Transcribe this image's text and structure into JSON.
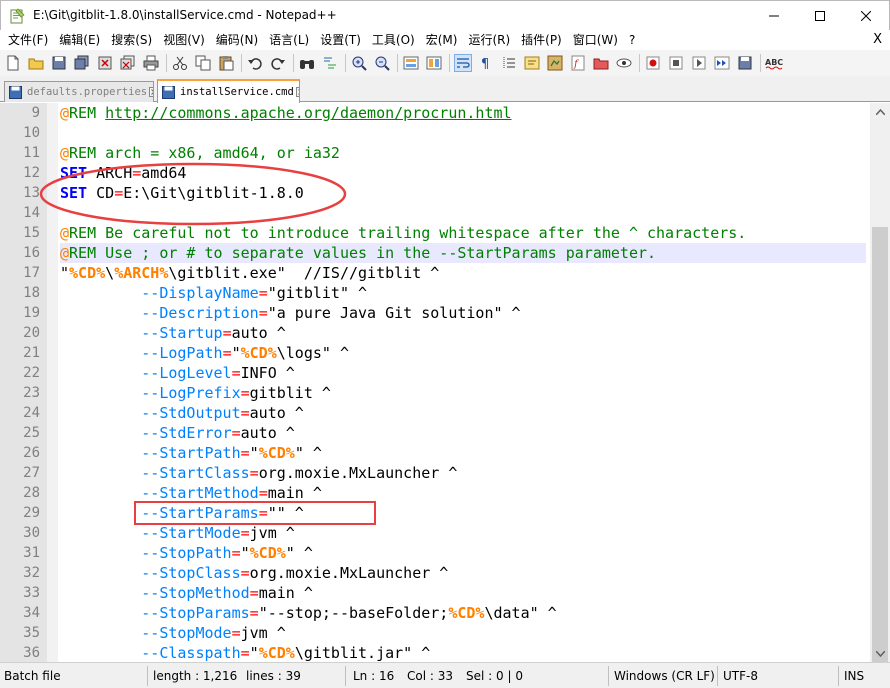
{
  "window": {
    "title": "E:\\Git\\gitblit-1.8.0\\installService.cmd - Notepad++"
  },
  "menu": {
    "items": [
      "文件(F)",
      "编辑(E)",
      "搜索(S)",
      "视图(V)",
      "编码(N)",
      "语言(L)",
      "设置(T)",
      "工具(O)",
      "宏(M)",
      "运行(R)",
      "插件(P)",
      "窗口(W)",
      "?"
    ],
    "close": "X"
  },
  "tabs": [
    {
      "label": "defaults.properties",
      "active": false
    },
    {
      "label": "installService.cmd",
      "active": true
    }
  ],
  "editor": {
    "current_line": 16,
    "lines": [
      {
        "n": "9"
      },
      {
        "n": "10"
      },
      {
        "n": "11"
      },
      {
        "n": "12"
      },
      {
        "n": "13"
      },
      {
        "n": "14"
      },
      {
        "n": "15"
      },
      {
        "n": "16"
      },
      {
        "n": "17"
      },
      {
        "n": "18"
      },
      {
        "n": "19"
      },
      {
        "n": "20"
      },
      {
        "n": "21"
      },
      {
        "n": "22"
      },
      {
        "n": "23"
      },
      {
        "n": "24"
      },
      {
        "n": "25"
      },
      {
        "n": "26"
      },
      {
        "n": "27"
      },
      {
        "n": "28"
      },
      {
        "n": "29"
      },
      {
        "n": "30"
      },
      {
        "n": "31"
      },
      {
        "n": "32"
      },
      {
        "n": "33"
      },
      {
        "n": "34"
      },
      {
        "n": "35"
      },
      {
        "n": "36"
      }
    ],
    "code": {
      "l9": {
        "at": "@",
        "rem": "REM ",
        "url": "http://commons.apache.org/daemon/procrun.html"
      },
      "l11": {
        "at": "@",
        "rem": "REM arch = x86, amd64, or ia32"
      },
      "l12": {
        "kw": "SET",
        "name": " ARCH",
        "op": "=",
        "val": "amd64"
      },
      "l13": {
        "kw": "SET",
        "name": " CD",
        "op": "=",
        "val": "E:\\Git\\gitblit-1.8.0"
      },
      "l15": {
        "at": "@",
        "rem": "REM Be careful not to introduce trailing whitespace after the ^ characters."
      },
      "l16": {
        "at": "@",
        "rem": "REM Use ; or # to separate values in the --StartParams parameter."
      },
      "l17": {
        "q1": "\"",
        "v1": "%CD%",
        "s1": "\\",
        "v2": "%ARCH%",
        "rest": "\\gitblit.exe\"  //IS//gitblit ^"
      },
      "l18": {
        "opt": "--DisplayName",
        "op": "=",
        "val": "\"gitblit\" ^"
      },
      "l19": {
        "opt": "--Description",
        "op": "=",
        "val": "\"a pure Java Git solution\" ^"
      },
      "l20": {
        "opt": "--Startup",
        "op": "=",
        "val": "auto ^"
      },
      "l21": {
        "opt": "--LogPath",
        "op": "=",
        "q": "\"",
        "var": "%CD%",
        "val": "\\logs\" ^"
      },
      "l22": {
        "opt": "--LogLevel",
        "op": "=",
        "val": "INFO ^"
      },
      "l23": {
        "opt": "--LogPrefix",
        "op": "=",
        "val": "gitblit ^"
      },
      "l24": {
        "opt": "--StdOutput",
        "op": "=",
        "val": "auto ^"
      },
      "l25": {
        "opt": "--StdError",
        "op": "=",
        "val": "auto ^"
      },
      "l26": {
        "opt": "--StartPath",
        "op": "=",
        "q": "\"",
        "var": "%CD%",
        "val": "\" ^"
      },
      "l27": {
        "opt": "--StartClass",
        "op": "=",
        "val": "org.moxie.MxLauncher ^"
      },
      "l28": {
        "opt": "--StartMethod",
        "op": "=",
        "val": "main ^"
      },
      "l29": {
        "opt": "--StartParams",
        "op": "=",
        "val": "\"\" ^"
      },
      "l30": {
        "opt": "--StartMode",
        "op": "=",
        "val": "jvm ^"
      },
      "l31": {
        "opt": "--StopPath",
        "op": "=",
        "q": "\"",
        "var": "%CD%",
        "val": "\" ^"
      },
      "l32": {
        "opt": "--StopClass",
        "op": "=",
        "val": "org.moxie.MxLauncher ^"
      },
      "l33": {
        "opt": "--StopMethod",
        "op": "=",
        "val": "main ^"
      },
      "l34": {
        "opt": "--StopParams",
        "op": "=",
        "q": "\"--stop;--baseFolder;",
        "var": "%CD%",
        "val": "\\data\" ^"
      },
      "l35": {
        "opt": "--StopMode",
        "op": "=",
        "val": "jvm ^"
      },
      "l36": {
        "opt": "--Classpath",
        "op": "=",
        "q": "\"",
        "var": "%CD%",
        "val": "\\gitblit.jar\" ^"
      }
    }
  },
  "status": {
    "filetype": "Batch file",
    "length": "length : 1,216",
    "lines": "lines : 39",
    "ln": "Ln : 16",
    "col": "Col : 33",
    "sel": "Sel : 0 | 0",
    "eol": "Windows (CR LF)",
    "encoding": "UTF-8",
    "mode": "INS"
  },
  "colors": {
    "keyword": "#0000ff",
    "comment": "#008000",
    "operator": "#ff0000",
    "variable": "#ff8000",
    "option": "#0080ff",
    "annotation": "#e84040",
    "tab_accent": "#f9a23b"
  }
}
